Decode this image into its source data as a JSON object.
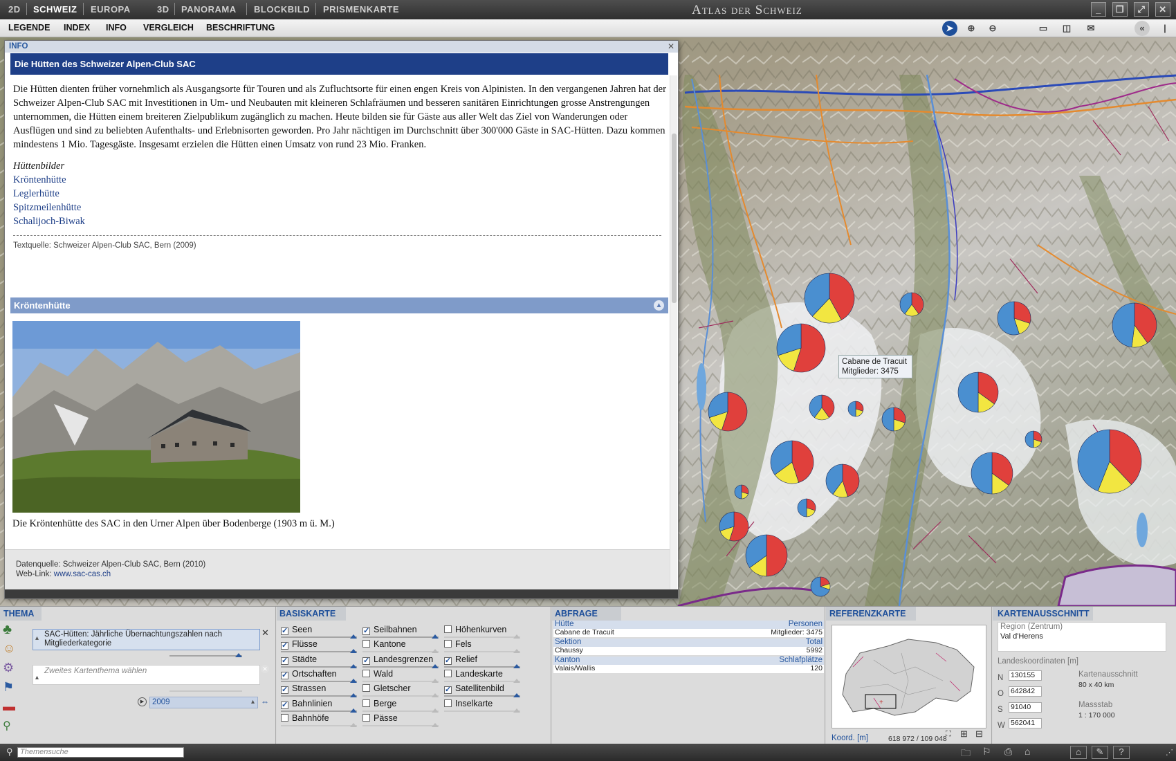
{
  "topbar": {
    "mode_2d": "2D",
    "schweiz": "SCHWEIZ",
    "europa": "EUROPA",
    "mode_3d": "3D",
    "panorama": "PANORAMA",
    "blockbild": "BLOCKBILD",
    "prismenkarte": "PRISMENKARTE",
    "app_title": "Atlas der Schweiz"
  },
  "menu": {
    "legende": "LEGENDE",
    "index": "INDEX",
    "info": "INFO",
    "vergleich": "VERGLEICH",
    "beschriftung": "BESCHRIFTUNG"
  },
  "info": {
    "header": "INFO",
    "close": "✕",
    "title": "Die Hütten des Schweizer Alpen-Club SAC",
    "paragraph": "Die Hütten dienten früher vornehmlich als Ausgangsorte für Touren und als Zufluchtsorte für einen engen Kreis von Alpinisten. In den vergangenen Jahren hat der Schweizer Alpen-Club SAC mit Investitionen in Um- und Neubauten mit kleineren Schlafräumen und besseren sanitären Einrichtungen grosse Anstrengungen unternommen, die Hütten einem breiteren Zielpublikum zugänglich zu machen. Heute bilden sie für Gäste aus aller Welt das Ziel von Wanderungen oder Ausflügen und sind zu beliebten Aufenthalts- und Erlebnisorten geworden. Pro Jahr nächtigen im Durchschnitt über 300'000 Gäste in SAC-Hütten. Dazu kommen mindestens 1 Mio. Tagesgäste. Insgesamt erzielen die Hütten einen Umsatz von rund 23 Mio. Franken.",
    "bilder_heading": "Hüttenbilder",
    "links": [
      "Kröntenhütte",
      "Leglerhütte",
      "Spitzmeilenhütte",
      "Schalijoch-Biwak"
    ],
    "textquelle": "Textquelle: Schweizer Alpen-Club SAC, Bern (2009)",
    "section_title": "Kröntenhütte",
    "caption": "Die Kröntenhütte des SAC in den Urner Alpen über Bodenberge (1903 m ü. M.)",
    "datenquelle": "Datenquelle: Schweizer Alpen-Club SAC, Bern (2010)",
    "weblink_label": "Web-Link: ",
    "weblink": "www.sac-cas.ch"
  },
  "map": {
    "tooltip_name": "Cabane de Tracuit",
    "tooltip_members": "Mitglieder: 3475",
    "colors": {
      "red": "#e0403c",
      "blue": "#4a8fd0",
      "yellow": "#f2e641"
    }
  },
  "thema": {
    "title": "THEMA",
    "selected": "SAC-Hütten: Jährliche Übernachtungszahlen nach Mitgliederkategorie",
    "second_placeholder": "Zweites Kartenthema wählen",
    "year": "2009",
    "search_placeholder": "Themensuche"
  },
  "basiskarte": {
    "title": "BASISKARTE",
    "col1": [
      {
        "label": "Seen",
        "checked": true
      },
      {
        "label": "Flüsse",
        "checked": true
      },
      {
        "label": "Städte",
        "checked": true
      },
      {
        "label": "Ortschaften",
        "checked": true
      },
      {
        "label": "Strassen",
        "checked": true
      },
      {
        "label": "Bahnlinien",
        "checked": true
      },
      {
        "label": "Bahnhöfe",
        "checked": false
      }
    ],
    "col2": [
      {
        "label": "Seilbahnen",
        "checked": true
      },
      {
        "label": "Kantone",
        "checked": false
      },
      {
        "label": "Landesgrenzen",
        "checked": true
      },
      {
        "label": "Wald",
        "checked": false
      },
      {
        "label": "Gletscher",
        "checked": false
      },
      {
        "label": "Berge",
        "checked": false
      },
      {
        "label": "Pässe",
        "checked": false
      }
    ],
    "col3": [
      {
        "label": "Höhenkurven",
        "checked": false
      },
      {
        "label": "Fels",
        "checked": false
      },
      {
        "label": "Relief",
        "checked": true
      },
      {
        "label": "Landeskarte",
        "checked": false
      },
      {
        "label": "Satellitenbild",
        "checked": true
      },
      {
        "label": "Inselkarte",
        "checked": false
      }
    ]
  },
  "abfrage": {
    "title": "ABFRAGE",
    "rows": [
      {
        "k1": "Hütte",
        "k2": "Personen",
        "v1": "Cabane de Tracuit",
        "v2": "Mitglieder: 3475"
      },
      {
        "k1": "Sektion",
        "k2": "Total",
        "v1": "Chaussy",
        "v2": "5992"
      },
      {
        "k1": "Kanton",
        "k2": "Schlafplätze",
        "v1": "Valais/Wallis",
        "v2": "120"
      }
    ]
  },
  "referenzkarte": {
    "title": "REFERENZKARTE",
    "koord_label": "Koord. [m]",
    "koord": "618 972 / 109 048"
  },
  "kartenausschnitt": {
    "title": "KARTENAUSSCHNITT",
    "region_label": "Region (Zentrum)",
    "region": "Val d'Herens",
    "coords_label": "Landeskoordinaten [m]",
    "n_label": "N",
    "n": "130155",
    "o_label": "O",
    "o": "642842",
    "s_label": "S",
    "s": "91040",
    "w_label": "W",
    "w": "562041",
    "ausschnitt_label": "Kartenausschnitt",
    "ausschnitt": "80 x 40 km",
    "massstab_label": "Massstab",
    "massstab": "1 : 170 000"
  }
}
